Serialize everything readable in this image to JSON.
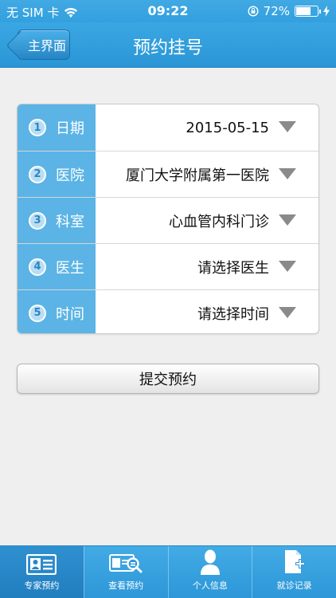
{
  "status_bar": {
    "carrier": "无 SIM 卡",
    "time": "09:22",
    "battery_percent": "72%",
    "battery_level": 0.72
  },
  "nav": {
    "back_label": "主界面",
    "title": "预约挂号"
  },
  "form": {
    "rows": [
      {
        "num": "1",
        "label": "日期",
        "value": "2015-05-15"
      },
      {
        "num": "2",
        "label": "医院",
        "value": "厦门大学附属第一医院"
      },
      {
        "num": "3",
        "label": "科室",
        "value": "心血管内科门诊"
      },
      {
        "num": "4",
        "label": "医生",
        "value": "请选择医生"
      },
      {
        "num": "5",
        "label": "时间",
        "value": "请选择时间"
      }
    ]
  },
  "submit_label": "提交预约",
  "tabs": [
    {
      "label": "专家预约",
      "icon": "id-card-icon"
    },
    {
      "label": "查看预约",
      "icon": "search-card-icon"
    },
    {
      "label": "个人信息",
      "icon": "person-icon"
    },
    {
      "label": "就诊记录",
      "icon": "document-add-icon"
    }
  ],
  "colors": {
    "primary": "#32a0df",
    "label_bg": "#5bb4e5",
    "background": "#efefef"
  }
}
